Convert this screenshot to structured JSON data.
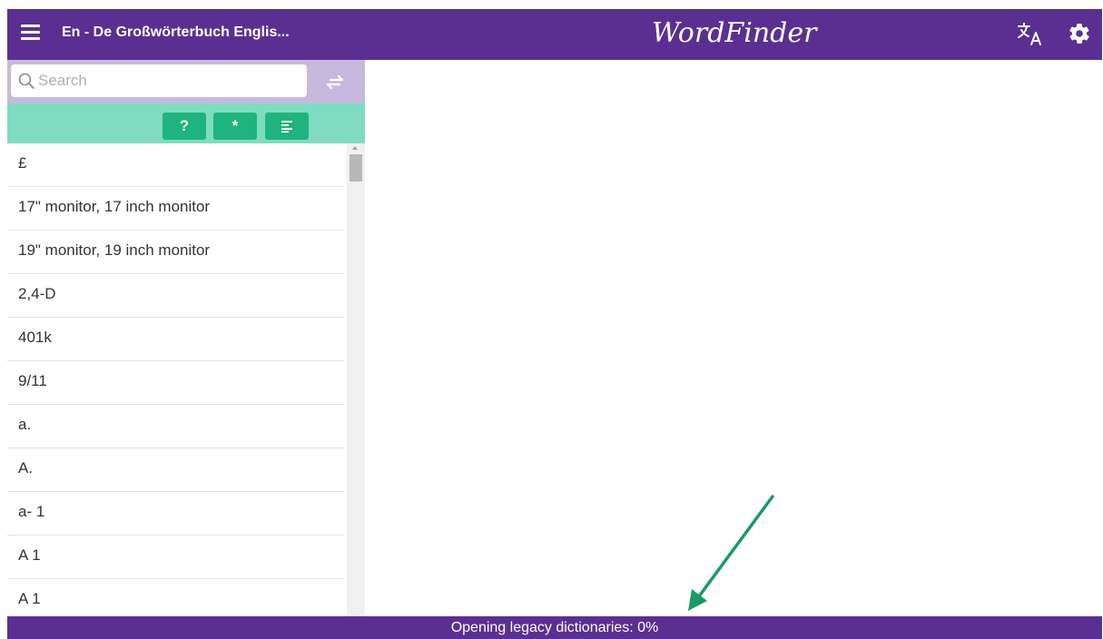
{
  "header": {
    "dictionary_title": "En - De Großwörterbuch Englis...",
    "app_title": "WordFinder",
    "background_color": "#5b2f91"
  },
  "search": {
    "placeholder": "Search",
    "value": ""
  },
  "toolbar": {
    "buttons": [
      {
        "label": "?",
        "icon": "question-icon"
      },
      {
        "label": "*",
        "icon": "asterisk-icon"
      },
      {
        "label": "",
        "icon": "text-lines-icon"
      }
    ],
    "background_color": "#7fdcc0",
    "button_color": "#1fb37f"
  },
  "word_list": [
    "£",
    "17\" monitor, 17 inch monitor",
    "19\" monitor, 19 inch monitor",
    "2,4-D",
    "401k",
    "9/11",
    "a.",
    "A.",
    "a- 1",
    "A 1",
    "A 1"
  ],
  "status_bar": {
    "text": "Opening legacy dictionaries: 0%",
    "progress_percent": 0
  },
  "annotation": {
    "arrow_color": "#1a9a64"
  }
}
